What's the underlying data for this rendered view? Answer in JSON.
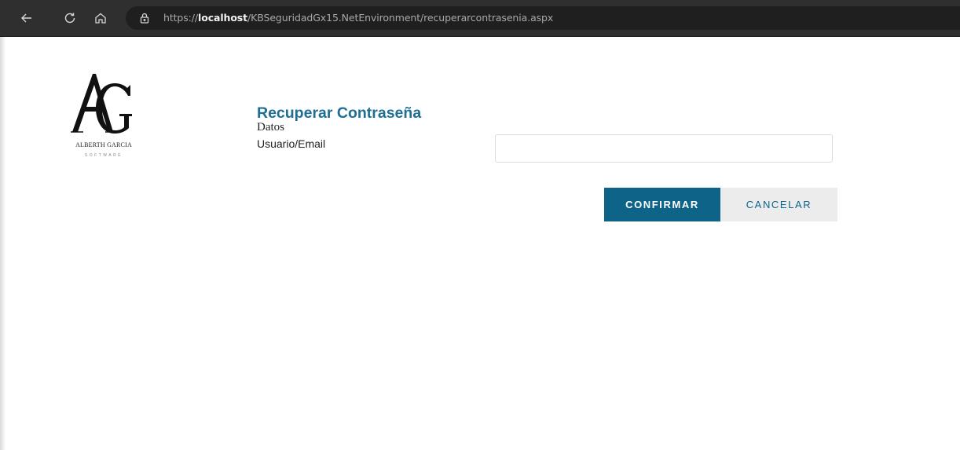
{
  "browser": {
    "url_prefix": "https://",
    "url_host": "localhost",
    "url_path": "/KBSeguridadGx15.NetEnvironment/recuperarcontrasenia.aspx",
    "icons": [
      "back-arrow-icon",
      "reload-icon",
      "home-icon",
      "lock-icon"
    ]
  },
  "logo": {
    "monogram": "AG",
    "name": "ALBERTH GARCIA",
    "tagline": "SOFTWARE"
  },
  "form": {
    "title": "Recuperar Contraseña",
    "section": "Datos",
    "user_label": "Usuario/Email",
    "user_value": "",
    "confirm_label": "CONFIRMAR",
    "cancel_label": "CANCELAR"
  },
  "colors": {
    "title": "#1f6e94",
    "primary_button": "#0d6388",
    "secondary_button": "#ececec",
    "browser_bar": "#2f2f2f"
  }
}
